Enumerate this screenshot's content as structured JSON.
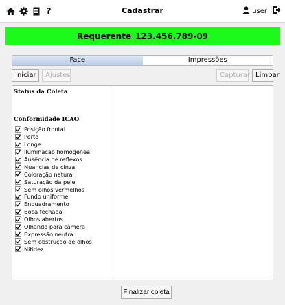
{
  "header": {
    "title": "Cadastrar",
    "user_label": "user",
    "icons": [
      "home-icon",
      "gear-icon",
      "document-icon",
      "help-icon",
      "user-icon",
      "logout-icon"
    ],
    "help_glyph": "?"
  },
  "banner": {
    "label": "Requerente",
    "id_number": "123.456.789-09",
    "color": "#1bfa1b"
  },
  "tabs": [
    {
      "label": "Face",
      "active": true
    },
    {
      "label": "Impressões",
      "active": false
    }
  ],
  "toolbar": {
    "start_label": "Iniciar",
    "adjust_label": "Ajustes",
    "capture_label": "Capturar",
    "clear_label": "Limpar"
  },
  "status": {
    "title": "Status da Coleta"
  },
  "icao": {
    "title": "Conformidade ICAO",
    "items": [
      {
        "label": "Posição frontal",
        "checked": true
      },
      {
        "label": "Perto",
        "checked": true
      },
      {
        "label": "Longe",
        "checked": true
      },
      {
        "label": "Iluminação homogênea",
        "checked": true
      },
      {
        "label": "Ausência de reflexos",
        "checked": true
      },
      {
        "label": "Nuancias de cinza",
        "checked": true
      },
      {
        "label": "Coloração natural",
        "checked": true
      },
      {
        "label": "Saturação da pele",
        "checked": true
      },
      {
        "label": "Sem olhos vermelhos",
        "checked": true
      },
      {
        "label": "Fundo uniforme",
        "checked": true
      },
      {
        "label": "Enquadramento",
        "checked": true
      },
      {
        "label": "Boca fechada",
        "checked": true
      },
      {
        "label": "Olhos abertos",
        "checked": true
      },
      {
        "label": "Olhando para câmera",
        "checked": true
      },
      {
        "label": "Expressão neutra",
        "checked": true
      },
      {
        "label": "Sem obstrução de olhos",
        "checked": true
      },
      {
        "label": "Nitidez",
        "checked": true
      }
    ]
  },
  "footer": {
    "finalize_label": "Finalizar coleta"
  }
}
